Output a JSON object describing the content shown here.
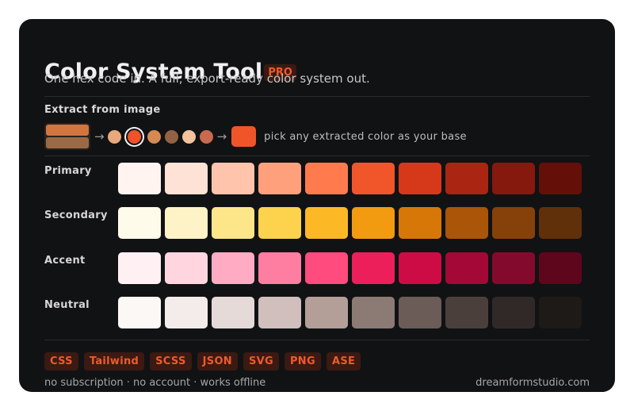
{
  "header": {
    "title": "Color System Tool",
    "badge": "PRO",
    "subtitle": "One hex code in. A full, export-ready color system out."
  },
  "extract": {
    "label": "Extract from image",
    "thumbnail_colors": [
      "#d2753e",
      "#9b6a44"
    ],
    "arrow": "→",
    "dots": [
      "#e8a97c",
      "#f0522a",
      "#d58a52",
      "#936245",
      "#f2c39c",
      "#c86a4f"
    ],
    "selected_dot_index": 1,
    "base_color": "#f0552a",
    "caption": "pick any extracted color as your base"
  },
  "scales": [
    {
      "label": "Primary",
      "swatches": [
        "#fff4f0",
        "#ffe2d6",
        "#ffc4ab",
        "#ffa07c",
        "#ff7b4e",
        "#f1562b",
        "#d6391a",
        "#aa2512",
        "#85190e",
        "#641009"
      ]
    },
    {
      "label": "Secondary",
      "swatches": [
        "#fffbeb",
        "#fef2c7",
        "#fde58a",
        "#fdd24c",
        "#fcb925",
        "#f29a10",
        "#d77708",
        "#aa5507",
        "#86410a",
        "#5f3009"
      ]
    },
    {
      "label": "Accent",
      "swatches": [
        "#fff0f3",
        "#ffd6e0",
        "#ffabc3",
        "#fe7ea1",
        "#ff4b7d",
        "#ec1f5b",
        "#cd0c45",
        "#a40836",
        "#840a2d",
        "#5e061c"
      ]
    },
    {
      "label": "Neutral",
      "swatches": [
        "#fbf8f6",
        "#f4eceb",
        "#e6dad9",
        "#d0bfbc",
        "#b39f98",
        "#8c7a74",
        "#6b5c57",
        "#4b3f3c",
        "#312928",
        "#1e1a18"
      ]
    }
  ],
  "exports": [
    "CSS",
    "Tailwind",
    "SCSS",
    "JSON",
    "SVG",
    "PNG",
    "ASE"
  ],
  "footer": {
    "tagline": "no subscription · no account · works offline",
    "site": "dreamformstudio.com"
  },
  "colors": {
    "background": "#111214",
    "accent": "#f05a2a",
    "chip_background": "#3a1a12"
  }
}
